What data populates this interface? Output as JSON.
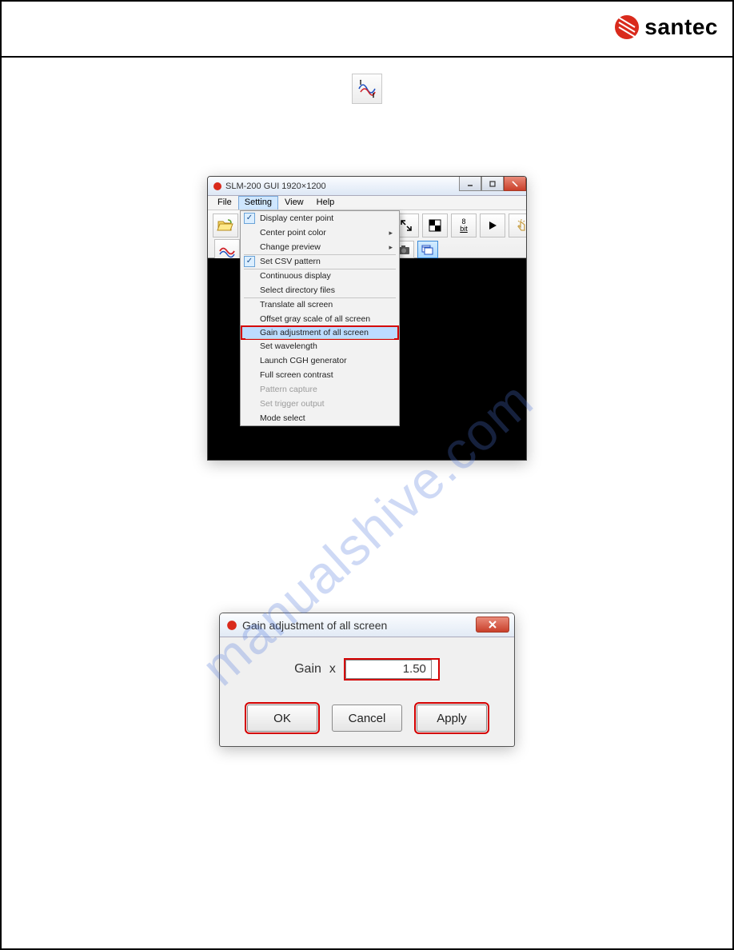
{
  "brand": {
    "name": "santec"
  },
  "watermark": "manualshive.com",
  "main_window": {
    "title": "SLM-200 GUI 1920×1200",
    "menus": [
      "File",
      "Setting",
      "View",
      "Help"
    ],
    "active_menu": "Setting",
    "dropdown": {
      "items": [
        {
          "label": "Display center point",
          "checked": true
        },
        {
          "label": "Center point color",
          "submenu": true
        },
        {
          "label": "Change preview",
          "submenu": true,
          "sep": true
        },
        {
          "label": "Set CSV pattern",
          "checked": true,
          "sep": true
        },
        {
          "label": "Continuous display"
        },
        {
          "label": "Select directory files",
          "sep": true
        },
        {
          "label": "Translate all screen"
        },
        {
          "label": "Offset gray scale of all screen"
        },
        {
          "label": "Gain adjustment of all screen",
          "highlight": true,
          "sep": true
        },
        {
          "label": "Set wavelength"
        },
        {
          "label": "Launch CGH generator"
        },
        {
          "label": "Full screen contrast"
        },
        {
          "label": "Pattern capture",
          "disabled": true
        },
        {
          "label": "Set trigger output",
          "disabled": true
        },
        {
          "label": "Mode select"
        }
      ]
    },
    "toolbar": {
      "left": [
        "open-file-icon",
        "wave-red-icon"
      ],
      "right_row1": [
        "fullscreen-icon",
        "checker-icon",
        "8bit-icon",
        "play-icon",
        "click-icon"
      ],
      "right_row2": [
        "camera-icon",
        "stack-icon"
      ],
      "bit_label": "8\nbit"
    }
  },
  "dialog": {
    "title": "Gain adjustment of all screen",
    "label_gain": "Gain",
    "label_x": "x",
    "value": "1.50",
    "buttons": {
      "ok": "OK",
      "cancel": "Cancel",
      "apply": "Apply"
    }
  }
}
